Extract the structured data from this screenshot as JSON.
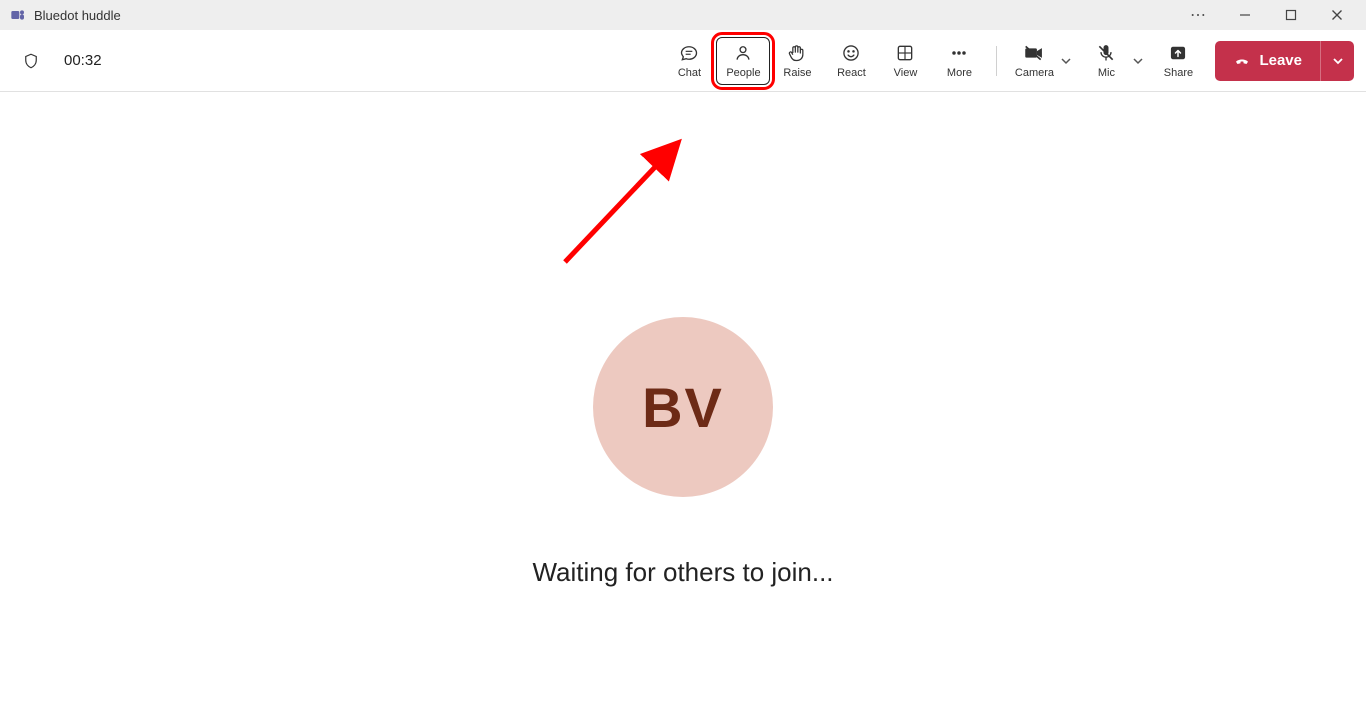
{
  "titlebar": {
    "title": "Bluedot huddle"
  },
  "toolbar": {
    "timer": "00:32",
    "buttons": {
      "chat": "Chat",
      "people": "People",
      "raise": "Raise",
      "react": "React",
      "view": "View",
      "more": "More",
      "camera": "Camera",
      "mic": "Mic",
      "share": "Share"
    },
    "leave_label": "Leave"
  },
  "main": {
    "avatar_initials": "BV",
    "waiting_text": "Waiting for others to join..."
  },
  "colors": {
    "leave_red": "#c4314b",
    "highlight_red": "#ff0000",
    "avatar_bg": "#edc9c0",
    "avatar_fg": "#6d2a16"
  }
}
